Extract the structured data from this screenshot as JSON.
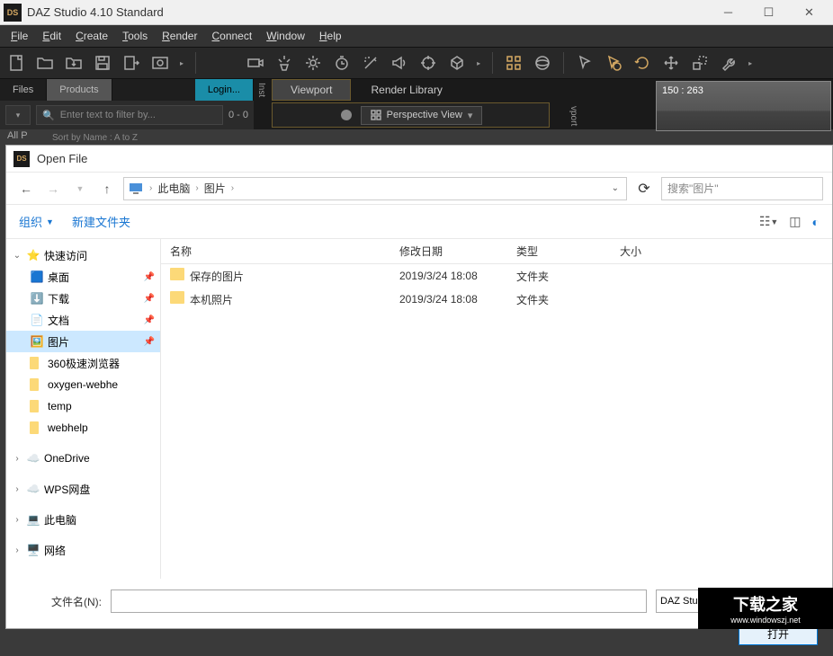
{
  "app": {
    "title": "DAZ Studio 4.10 Standard",
    "logo": "DS"
  },
  "menu": [
    "File",
    "Edit",
    "Create",
    "Tools",
    "Render",
    "Connect",
    "Window",
    "Help"
  ],
  "tabs": {
    "left": {
      "files": "Files",
      "products": "Products",
      "login": "Login..."
    },
    "mid": {
      "viewport": "Viewport",
      "render_library": "Render Library"
    }
  },
  "filter": {
    "placeholder": "Enter text to filter by...",
    "count": "0 - 0",
    "allp": "All P",
    "sort": "Sort by Name : A to Z"
  },
  "viewport": {
    "label": "Perspective View",
    "preview_coords": "150 : 263"
  },
  "side": {
    "inst": "Inst",
    "vport": "vport"
  },
  "dialog": {
    "title": "Open File",
    "breadcrumb": {
      "root": "此电脑",
      "current": "图片"
    },
    "search_placeholder": "搜索\"图片\"",
    "toolbar": {
      "organize": "组织",
      "new_folder": "新建文件夹"
    },
    "columns": {
      "name": "名称",
      "date": "修改日期",
      "type": "类型",
      "size": "大小"
    },
    "files": [
      {
        "name": "保存的图片",
        "date": "2019/3/24 18:08",
        "type": "文件夹"
      },
      {
        "name": "本机照片",
        "date": "2019/3/24 18:08",
        "type": "文件夹"
      }
    ],
    "tree": {
      "quick": "快速访问",
      "desktop": "桌面",
      "downloads": "下载",
      "documents": "文档",
      "pictures": "图片",
      "f1": "360极速浏览器",
      "f2": "oxygen-webhe",
      "f3": "temp",
      "f4": "webhelp",
      "onedrive": "OneDrive",
      "wps": "WPS网盘",
      "thispc": "此电脑",
      "network": "网络"
    },
    "filename_label": "文件名(N):",
    "file_type": "DAZ Studio Files (*.duf; *.dsf;",
    "open_btn": "打开"
  },
  "watermark": {
    "main": "下载之家",
    "sub": "www.windowszj.net"
  }
}
